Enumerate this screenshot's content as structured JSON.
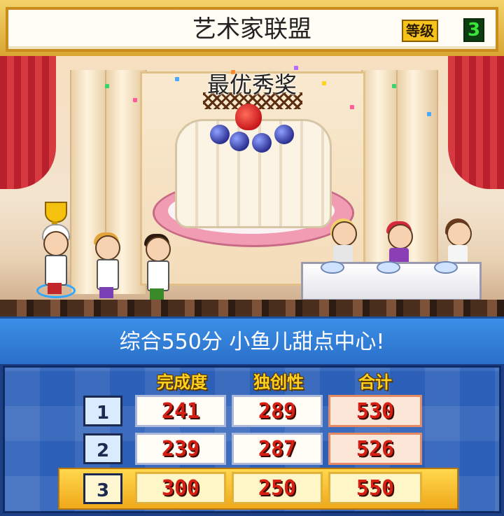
{
  "header": {
    "title": "艺术家联盟",
    "level_label": "等级",
    "level_value": "3"
  },
  "scene": {
    "award_title": "最优秀奖"
  },
  "banner": {
    "text": "综合550分 小鱼儿甜点中心!"
  },
  "score_table": {
    "columns": [
      "完成度",
      "独创性",
      "合计"
    ],
    "rows": [
      {
        "rank": "1",
        "completion": "241",
        "originality": "289",
        "total": "530",
        "current": false
      },
      {
        "rank": "2",
        "completion": "239",
        "originality": "287",
        "total": "526",
        "current": false
      },
      {
        "rank": "3",
        "completion": "300",
        "originality": "250",
        "total": "550",
        "current": true
      }
    ]
  },
  "colors": {
    "header_gold": "#d9a532",
    "banner_blue": "#3b8ee6",
    "board_blue": "#2c5fb8",
    "score_red": "#d61e12",
    "highlight_yellow": "#ffd74d"
  },
  "icons": [
    "trophy-icon",
    "confetti"
  ]
}
